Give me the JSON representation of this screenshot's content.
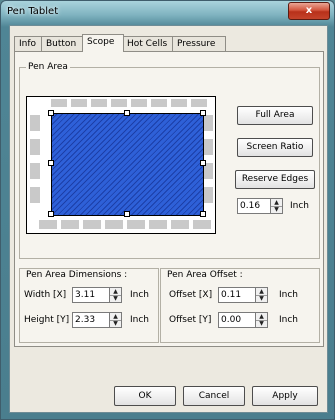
{
  "window": {
    "title": "Pen Tablet",
    "close_label": "x"
  },
  "tabs": [
    {
      "label": "Info",
      "active": false
    },
    {
      "label": "Button",
      "active": false
    },
    {
      "label": "Scope",
      "active": true
    },
    {
      "label": "Hot Cells",
      "active": false
    },
    {
      "label": "Pressure",
      "active": false
    }
  ],
  "pen_area": {
    "title": "Pen Area",
    "full_area_label": "Full Area",
    "screen_ratio_label": "Screen Ratio",
    "reserve_edges_label": "Reserve Edges",
    "edge_value": "0.16",
    "edge_unit": "Inch"
  },
  "dimensions": {
    "title": "Pen Area Dimensions :",
    "width_label": "Width [X]",
    "width_value": "3.11",
    "height_label": "Height [Y]",
    "height_value": "2.33",
    "unit": "Inch"
  },
  "offset": {
    "title": "Pen Area Offset :",
    "x_label": "Offset [X]",
    "x_value": "0.11",
    "y_label": "Offset [Y]",
    "y_value": "0.00",
    "unit": "Inch"
  },
  "footer": {
    "ok_label": "OK",
    "cancel_label": "Cancel",
    "apply_label": "Apply"
  },
  "colors": {
    "active_area": "#2e60d8",
    "title_bar": "#4f8595",
    "close_button": "#c4432a"
  }
}
